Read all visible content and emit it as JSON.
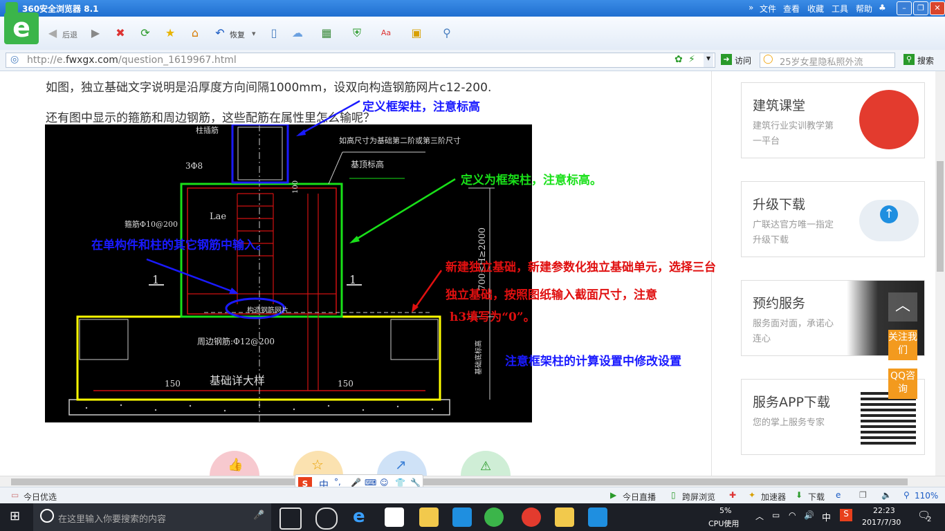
{
  "window": {
    "title": "360安全浏览器 8.1",
    "menu": [
      "文件",
      "查看",
      "收藏",
      "工具",
      "帮助"
    ]
  },
  "toolbar": {
    "back_label": "后退",
    "restore_label": "恢复"
  },
  "address": {
    "url_prefix": "http://e.",
    "url_domain": "fwxgx.com",
    "url_path": "/question_1619967.html",
    "visit_label": "访问",
    "search_placeholder": "25岁女星隐私照外流",
    "search_button": "搜索"
  },
  "question": {
    "line1": "如图，独立基础文字说明是沿厚度方向间隔1000mm，设双向构造钢筋网片c12-200.",
    "line2": "还有图中显示的箍筋和周边钢筋，这些配筋在属性里怎么输呢？"
  },
  "cad_labels": {
    "col_rebar": "柱插筋",
    "top_note": "如高尺寸为基础第二阶或第三阶尺寸",
    "rebar_3": "3Φ8",
    "top_elev": "基顶标高",
    "lae": "Lae",
    "stirrup": "箍筋Φ10@200",
    "mesh": "构造钢筋网片",
    "peri": "周边钢筋:Φ12@200",
    "detail": "基础详大样",
    "dim_150a": "150",
    "dim_150b": "150",
    "dim_height": "700≤H≥2000",
    "elev_side": "基础底标高",
    "sec_a": "1",
    "sec_b": "1",
    "dim_100": "100"
  },
  "annotations": {
    "a1": "定义框架柱，注意标高",
    "a2": "定义为框架柱，注意标高。",
    "a3": "在单构件和柱的其它钢筋中输入。",
    "a4_l1": "新建独立基础，新建参数化独立基础单元，选择三台",
    "a4_l2": "独立基础，按照图纸输入截面尺寸，注意",
    "a4_l3": "h3填写为“0”。",
    "a5": "注意框架柱的计算设置中修改设置"
  },
  "sidebar": [
    {
      "title": "建筑课堂",
      "sub": "建筑行业实训教学第一平台"
    },
    {
      "title": "升级下载",
      "sub": "广联达官方唯一指定升级下载"
    },
    {
      "title": "预约服务",
      "sub": "服务面对面，承诺心连心"
    },
    {
      "title": "服务APP下载",
      "sub": "您的掌上服务专家"
    }
  ],
  "side_buttons": {
    "follow": "关注我们",
    "qq": "QQ咨询"
  },
  "ime": {
    "mode": "中"
  },
  "statusbar": {
    "left": "今日优选",
    "live": "今日直播",
    "cross": "跨屏浏览",
    "accel": "加速器",
    "download": "下载",
    "zoom": "110%"
  },
  "taskbar": {
    "search_placeholder": "在这里输入你要搜索的内容",
    "cpu_pct": "5%",
    "cpu_label": "CPU使用",
    "ime": "中",
    "time": "22:23",
    "date": "2017/7/30",
    "notif_count": "2"
  },
  "colors": {
    "annotation_blue": "#1a1aff",
    "annotation_green": "#19e019",
    "annotation_red": "#e01010",
    "cad_yellow": "#ffff00",
    "cad_rebar": "#d01010"
  }
}
